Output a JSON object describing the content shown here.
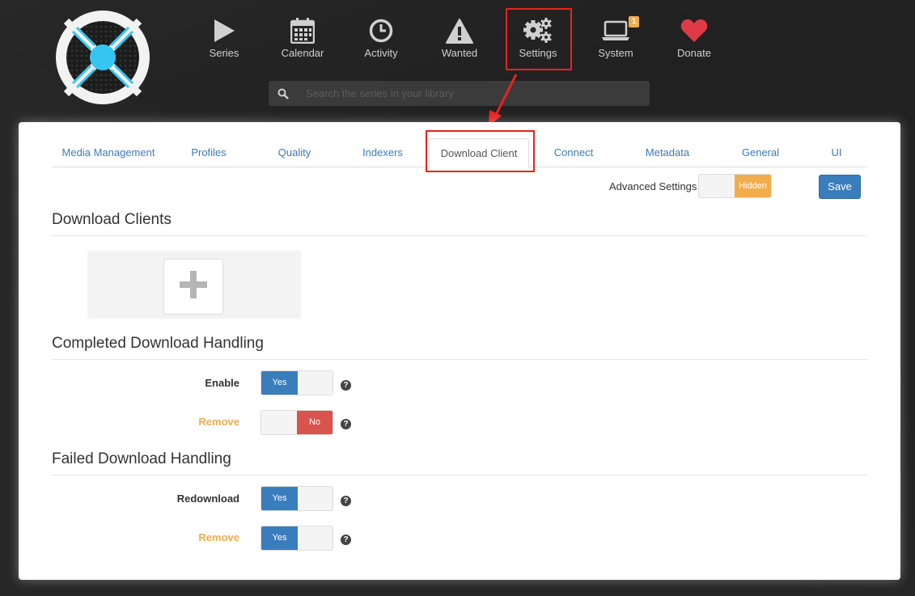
{
  "nav": {
    "items": [
      {
        "label": "Series",
        "icon": "play-icon"
      },
      {
        "label": "Calendar",
        "icon": "calendar-icon"
      },
      {
        "label": "Activity",
        "icon": "clock-icon"
      },
      {
        "label": "Wanted",
        "icon": "warning-icon"
      },
      {
        "label": "Settings",
        "icon": "gears-icon"
      },
      {
        "label": "System",
        "icon": "laptop-icon"
      },
      {
        "label": "Donate",
        "icon": "heart-icon"
      }
    ],
    "system_badge": "1"
  },
  "search": {
    "placeholder": "Search the series in your library"
  },
  "tabs": [
    {
      "label": "Media Management"
    },
    {
      "label": "Profiles"
    },
    {
      "label": "Quality"
    },
    {
      "label": "Indexers"
    },
    {
      "label": "Download Client"
    },
    {
      "label": "Connect"
    },
    {
      "label": "Metadata"
    },
    {
      "label": "General"
    },
    {
      "label": "UI"
    }
  ],
  "toolbar": {
    "advanced_label": "Advanced Settings",
    "advanced_state": "Hidden",
    "save_label": "Save"
  },
  "sections": {
    "download_clients": "Download Clients",
    "completed": "Completed Download Handling",
    "failed": "Failed Download Handling"
  },
  "fields": {
    "completed_enable": {
      "label": "Enable",
      "value": "Yes"
    },
    "completed_remove": {
      "label": "Remove",
      "value": "No"
    },
    "failed_redownload": {
      "label": "Redownload",
      "value": "Yes"
    },
    "failed_remove": {
      "label": "Remove",
      "value": "Yes"
    }
  },
  "help_glyph": "?",
  "colors": {
    "accent": "#3a7dbd",
    "warning": "#f0ad4e",
    "danger": "#d9534f",
    "highlight": "#e8231f",
    "logo_blue": "#35c5f0"
  }
}
